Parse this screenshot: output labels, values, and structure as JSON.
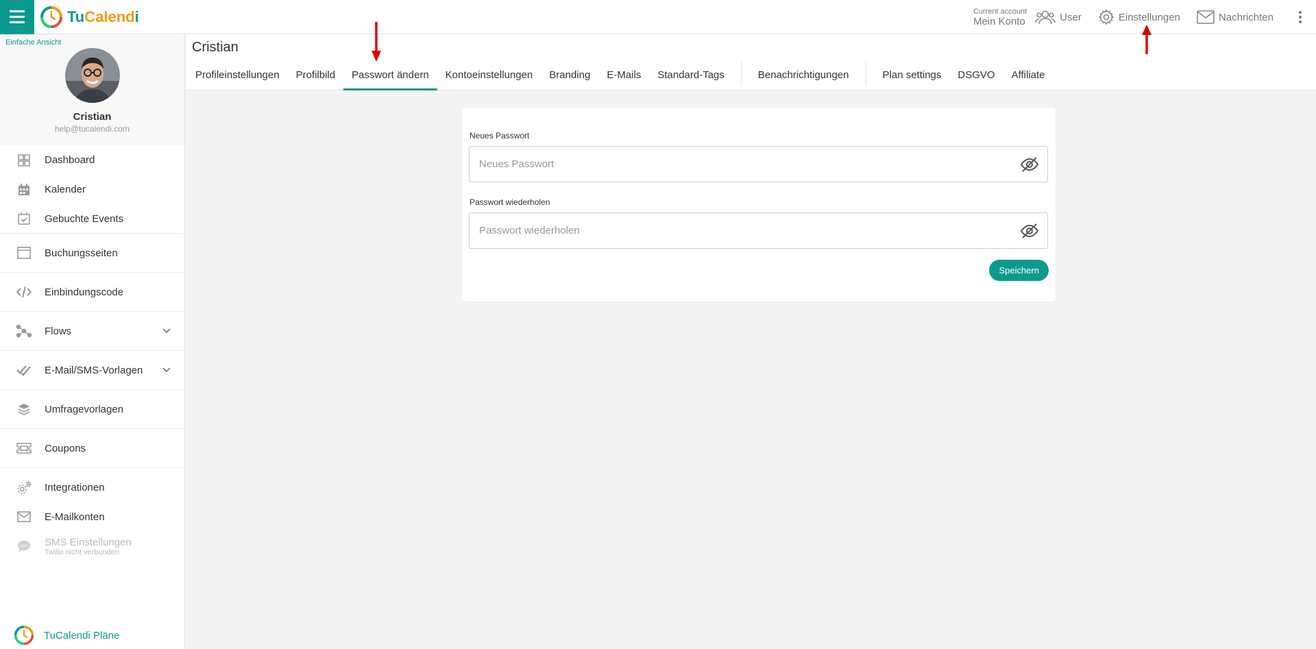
{
  "brand": {
    "name_a": "Tu",
    "name_b": "Calend",
    "name_c": "i"
  },
  "account": {
    "label": "Current account",
    "name": "Mein Konto"
  },
  "topnav": {
    "user": "User",
    "settings": "Einstellungen",
    "messages": "Nachrichten"
  },
  "sidebar": {
    "simple_view": "Einfache Ansicht",
    "profile_name": "Cristian",
    "profile_email": "help@tucalendi.com",
    "items": [
      {
        "label": "Dashboard",
        "icon": "dashboard-icon"
      },
      {
        "label": "Kalender",
        "icon": "calendar-icon"
      },
      {
        "label": "Gebuchte Events",
        "icon": "calendar-check-icon"
      },
      {
        "label": "Buchungsseiten",
        "icon": "browser-icon"
      },
      {
        "label": "Einbindungscode",
        "icon": "code-icon"
      },
      {
        "label": "Flows",
        "icon": "flow-icon"
      },
      {
        "label": "E-Mail/SMS-Vorlagen",
        "icon": "double-check-icon"
      },
      {
        "label": "Umfragevorlagen",
        "icon": "layers-icon"
      },
      {
        "label": "Coupons",
        "icon": "ticket-icon"
      },
      {
        "label": "Integrationen",
        "icon": "gears-icon"
      },
      {
        "label": "E-Mailkonten",
        "icon": "envelope-icon"
      },
      {
        "label": "SMS Einstellungen",
        "sub": "Twilio nicht verbunden",
        "icon": "sms-icon"
      }
    ],
    "plans": "TuCalendi Pläne"
  },
  "page": {
    "title": "Cristian",
    "tabs": [
      "Profileinstellungen",
      "Profilbild",
      "Passwort ändern",
      "Kontoeinstellungen",
      "Branding",
      "E-Mails",
      "Standard-Tags",
      "Benachrichtigungen",
      "Plan settings",
      "DSGVO",
      "Affiliate"
    ],
    "active_tab": "Passwort ändern"
  },
  "form": {
    "new_password_label": "Neues Passwort",
    "new_password_placeholder": "Neues Passwort",
    "repeat_password_label": "Passwort wiederholen",
    "repeat_password_placeholder": "Passwort wiederholen",
    "save": "Speichern"
  },
  "colors": {
    "accent": "#0b9a8d",
    "brand_orange": "#f39c12",
    "annotation_red": "#e00000"
  }
}
